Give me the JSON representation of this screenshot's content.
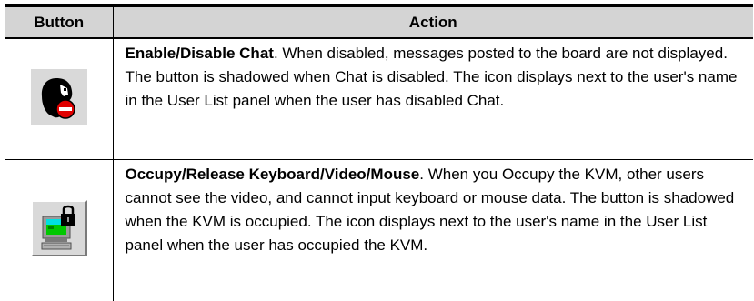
{
  "table": {
    "headers": {
      "button": "Button",
      "action": "Action"
    },
    "rows": [
      {
        "icon": "chat-disabled-face-icon",
        "title": "Enable/Disable Chat",
        "text": ". When disabled, messages posted to the board are not displayed. The button is shadowed when Chat is disabled. The icon displays next to the user's name in the User List panel when the user has disabled Chat."
      },
      {
        "icon": "occupy-kvm-computer-lock-icon",
        "title": "Occupy/Release Keyboard/Video/Mouse",
        "text": ". When you Occupy the KVM, other users cannot see the video, and cannot input keyboard or mouse data. The button is shadowed when the KVM is occupied. The icon displays next to the user's name in the User List panel when the user has occupied the KVM."
      }
    ]
  },
  "colors": {
    "header_bg": "#d4d4d4",
    "icon_bg": "#d9d9d9",
    "no_entry_red": "#e00000",
    "screen_green": "#00c800",
    "screen_cyan": "#00e0e0"
  }
}
